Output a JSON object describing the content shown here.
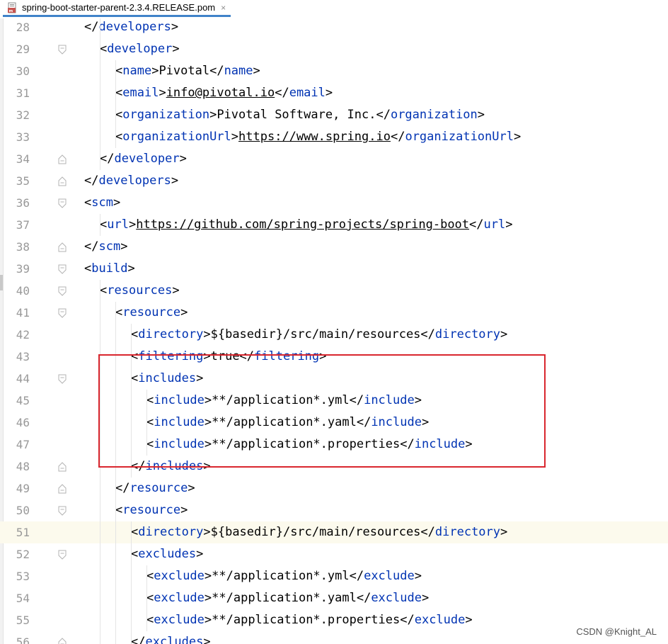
{
  "tab": {
    "title": "spring-boot-starter-parent-2.3.4.RELEASE.pom",
    "close_glyph": "×",
    "icon": "maven-file-icon"
  },
  "editor": {
    "current_line": 51,
    "lines": [
      {
        "n": 28,
        "fold": "none",
        "indent": 0,
        "parts": [
          [
            "t",
            "</"
          ],
          [
            "g",
            "developers"
          ],
          [
            "t",
            ">"
          ]
        ]
      },
      {
        "n": 29,
        "fold": "open",
        "indent": 1,
        "parts": [
          [
            "t",
            "<"
          ],
          [
            "g",
            "developer"
          ],
          [
            "t",
            ">"
          ]
        ]
      },
      {
        "n": 30,
        "fold": "none",
        "indent": 2,
        "parts": [
          [
            "t",
            "<"
          ],
          [
            "g",
            "name"
          ],
          [
            "t",
            ">Pivotal</"
          ],
          [
            "g",
            "name"
          ],
          [
            "t",
            ">"
          ]
        ]
      },
      {
        "n": 31,
        "fold": "none",
        "indent": 2,
        "parts": [
          [
            "t",
            "<"
          ],
          [
            "g",
            "email"
          ],
          [
            "t",
            ">"
          ],
          [
            "u",
            "info@pivotal.io"
          ],
          [
            "t",
            "</"
          ],
          [
            "g",
            "email"
          ],
          [
            "t",
            ">"
          ]
        ]
      },
      {
        "n": 32,
        "fold": "none",
        "indent": 2,
        "parts": [
          [
            "t",
            "<"
          ],
          [
            "g",
            "organization"
          ],
          [
            "t",
            ">Pivotal Software, Inc.</"
          ],
          [
            "g",
            "organization"
          ],
          [
            "t",
            ">"
          ]
        ]
      },
      {
        "n": 33,
        "fold": "none",
        "indent": 2,
        "parts": [
          [
            "t",
            "<"
          ],
          [
            "g",
            "organizationUrl"
          ],
          [
            "t",
            ">"
          ],
          [
            "u",
            "https://www.spring.io"
          ],
          [
            "t",
            "</"
          ],
          [
            "g",
            "organizationUrl"
          ],
          [
            "t",
            ">"
          ]
        ]
      },
      {
        "n": 34,
        "fold": "close",
        "indent": 1,
        "parts": [
          [
            "t",
            "</"
          ],
          [
            "g",
            "developer"
          ],
          [
            "t",
            ">"
          ]
        ]
      },
      {
        "n": 35,
        "fold": "close",
        "indent": 0,
        "parts": [
          [
            "t",
            "</"
          ],
          [
            "g",
            "developers"
          ],
          [
            "t",
            ">"
          ]
        ]
      },
      {
        "n": 36,
        "fold": "open",
        "indent": 0,
        "parts": [
          [
            "t",
            "<"
          ],
          [
            "g",
            "scm"
          ],
          [
            "t",
            ">"
          ]
        ]
      },
      {
        "n": 37,
        "fold": "none",
        "indent": 1,
        "parts": [
          [
            "t",
            "<"
          ],
          [
            "g",
            "url"
          ],
          [
            "t",
            ">"
          ],
          [
            "u",
            "https://github.com/spring-projects/spring-boot"
          ],
          [
            "t",
            "</"
          ],
          [
            "g",
            "url"
          ],
          [
            "t",
            ">"
          ]
        ]
      },
      {
        "n": 38,
        "fold": "close",
        "indent": 0,
        "parts": [
          [
            "t",
            "</"
          ],
          [
            "g",
            "scm"
          ],
          [
            "t",
            ">"
          ]
        ]
      },
      {
        "n": 39,
        "fold": "open",
        "indent": 0,
        "parts": [
          [
            "t",
            "<"
          ],
          [
            "g",
            "build"
          ],
          [
            "t",
            ">"
          ]
        ]
      },
      {
        "n": 40,
        "fold": "open",
        "indent": 1,
        "parts": [
          [
            "t",
            "<"
          ],
          [
            "g",
            "resources"
          ],
          [
            "t",
            ">"
          ]
        ]
      },
      {
        "n": 41,
        "fold": "open",
        "indent": 2,
        "parts": [
          [
            "t",
            "<"
          ],
          [
            "g",
            "resource"
          ],
          [
            "t",
            ">"
          ]
        ]
      },
      {
        "n": 42,
        "fold": "none",
        "indent": 3,
        "parts": [
          [
            "t",
            "<"
          ],
          [
            "g",
            "directory"
          ],
          [
            "t",
            ">${basedir}/src/main/resources</"
          ],
          [
            "g",
            "directory"
          ],
          [
            "t",
            ">"
          ]
        ]
      },
      {
        "n": 43,
        "fold": "none",
        "indent": 3,
        "parts": [
          [
            "t",
            "<"
          ],
          [
            "g",
            "filtering"
          ],
          [
            "t",
            ">true</"
          ],
          [
            "g",
            "filtering"
          ],
          [
            "t",
            ">"
          ]
        ]
      },
      {
        "n": 44,
        "fold": "open",
        "indent": 3,
        "parts": [
          [
            "t",
            "<"
          ],
          [
            "g",
            "includes"
          ],
          [
            "t",
            ">"
          ]
        ]
      },
      {
        "n": 45,
        "fold": "none",
        "indent": 4,
        "parts": [
          [
            "t",
            "<"
          ],
          [
            "g",
            "include"
          ],
          [
            "t",
            ">**/application*.yml</"
          ],
          [
            "g",
            "include"
          ],
          [
            "t",
            ">"
          ]
        ]
      },
      {
        "n": 46,
        "fold": "none",
        "indent": 4,
        "parts": [
          [
            "t",
            "<"
          ],
          [
            "g",
            "include"
          ],
          [
            "t",
            ">**/application*.yaml</"
          ],
          [
            "g",
            "include"
          ],
          [
            "t",
            ">"
          ]
        ]
      },
      {
        "n": 47,
        "fold": "none",
        "indent": 4,
        "parts": [
          [
            "t",
            "<"
          ],
          [
            "g",
            "include"
          ],
          [
            "t",
            ">**/application*.properties</"
          ],
          [
            "g",
            "include"
          ],
          [
            "t",
            ">"
          ]
        ]
      },
      {
        "n": 48,
        "fold": "close",
        "indent": 3,
        "parts": [
          [
            "t",
            "</"
          ],
          [
            "g",
            "includes"
          ],
          [
            "t",
            ">"
          ]
        ]
      },
      {
        "n": 49,
        "fold": "close",
        "indent": 2,
        "parts": [
          [
            "t",
            "</"
          ],
          [
            "g",
            "resource"
          ],
          [
            "t",
            ">"
          ]
        ]
      },
      {
        "n": 50,
        "fold": "open",
        "indent": 2,
        "parts": [
          [
            "t",
            "<"
          ],
          [
            "g",
            "resource"
          ],
          [
            "t",
            ">"
          ]
        ]
      },
      {
        "n": 51,
        "fold": "none",
        "indent": 3,
        "parts": [
          [
            "t",
            "<"
          ],
          [
            "g",
            "directory"
          ],
          [
            "t",
            ">${basedir}/src/main/resources</"
          ],
          [
            "g",
            "directory"
          ],
          [
            "t",
            ">"
          ]
        ]
      },
      {
        "n": 52,
        "fold": "open",
        "indent": 3,
        "parts": [
          [
            "t",
            "<"
          ],
          [
            "g",
            "excludes"
          ],
          [
            "t",
            ">"
          ]
        ]
      },
      {
        "n": 53,
        "fold": "none",
        "indent": 4,
        "parts": [
          [
            "t",
            "<"
          ],
          [
            "g",
            "exclude"
          ],
          [
            "t",
            ">**/application*.yml</"
          ],
          [
            "g",
            "exclude"
          ],
          [
            "t",
            ">"
          ]
        ]
      },
      {
        "n": 54,
        "fold": "none",
        "indent": 4,
        "parts": [
          [
            "t",
            "<"
          ],
          [
            "g",
            "exclude"
          ],
          [
            "t",
            ">**/application*.yaml</"
          ],
          [
            "g",
            "exclude"
          ],
          [
            "t",
            ">"
          ]
        ]
      },
      {
        "n": 55,
        "fold": "none",
        "indent": 4,
        "parts": [
          [
            "t",
            "<"
          ],
          [
            "g",
            "exclude"
          ],
          [
            "t",
            ">**/application*.properties</"
          ],
          [
            "g",
            "exclude"
          ],
          [
            "t",
            ">"
          ]
        ]
      },
      {
        "n": 56,
        "fold": "close",
        "indent": 3,
        "parts": [
          [
            "t",
            "</"
          ],
          [
            "g",
            "excludes"
          ],
          [
            "t",
            ">"
          ]
        ]
      }
    ]
  },
  "annotation": {
    "label": "highlight-box-includes",
    "color": "#d9262e"
  },
  "colors": {
    "tag": "#0033b3",
    "text": "#000000",
    "line_number": "#999999",
    "current_line_bg": "#fcfaed",
    "tab_underline": "#4083c9"
  },
  "watermark": "CSDN @Knight_AL"
}
